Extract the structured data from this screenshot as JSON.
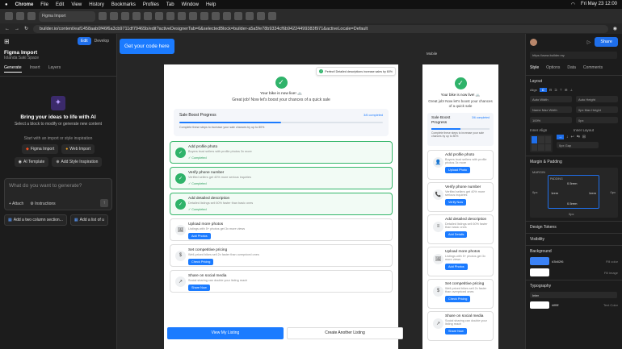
{
  "mac": {
    "menu": [
      "Chrome",
      "File",
      "Edit",
      "View",
      "History",
      "Bookmarks",
      "Profiles",
      "Tab",
      "Window",
      "Help"
    ],
    "datetime": "Fri May 23 12:00"
  },
  "tab": {
    "title": "Figma Import"
  },
  "address": {
    "url": "builder.io/content/eaf1458aab0f46f6a3cb9711df79465b/edit?activeDesignerTab=6&selectedBlock=builder-a5a5fe78b9334cf6b94224499383f971&activeLocale=Default"
  },
  "tooltip": {
    "text": "Get your code here"
  },
  "left": {
    "title": "Figma Import",
    "subtitle": "Iolanda Saki Space",
    "edit": "Edit",
    "develop": "Develop",
    "tabs": [
      "Generate",
      "Insert",
      "Layers"
    ],
    "headline": "Bring your ideas to life with AI",
    "sub": "Select a block to modify or generate new content",
    "start": "Start with an import or style inspiration",
    "figma": "Figma Import",
    "web": "Web Import",
    "ait": "AI Template",
    "style": "Add Style Inspiration",
    "placeholder": "What do you want to generate?",
    "attach": "Attach",
    "instructions": "Instructions",
    "s1": "Add a two column section...",
    "s2": "Add a list of u"
  },
  "main": {
    "toast": "Perfect! Detailed descriptions increase sales by 60%",
    "live": "Your bike is now live! 🚲",
    "great": "Great job! Now let's boost your chances of a quick sale",
    "sbp": "Sale Boost Progress",
    "completed": "3/6 completed",
    "hint": "Complete these steps to increase your sale chances by up to 80%",
    "tasks": [
      {
        "t": "Add profile photo",
        "d": "Buyers trust sellers with profile photos 3x more",
        "c": "✓ Completed",
        "b": ""
      },
      {
        "t": "Verify phone number",
        "d": "Verified sellers get 40% more serious inquiries",
        "c": "✓ Completed",
        "b": ""
      },
      {
        "t": "Add detailed description",
        "d": "Detailed listings sell 60% faster than basic ones",
        "c": "✓ Completed",
        "b": ""
      },
      {
        "t": "Upload more photos",
        "d": "Listings with 5+ photos get 3x more views",
        "c": "",
        "b": "Add Photos"
      },
      {
        "t": "Set competitive pricing",
        "d": "Well-priced bikes sell 2x faster than overpriced ones",
        "c": "",
        "b": "Check Pricing"
      },
      {
        "t": "Share on social media",
        "d": "Social sharing can double your listing reach",
        "c": "",
        "b": "Share Now"
      }
    ],
    "view": "View My Listing",
    "create": "Create Another Listing"
  },
  "mobile": {
    "label": "Mobile",
    "live": "Your bike is now live! 🚲",
    "great": "Great job! Now let's boost your chances of a quick sale",
    "sbp": "Sale Boost Progress",
    "completed": "3/6 completed",
    "hint": "Complete these steps to increase your sale chances by up to 80%",
    "tasks": [
      {
        "t": "Add profile photo",
        "d": "Buyers trust sellers with profile photos 3x more",
        "b": "Upload Photo"
      },
      {
        "t": "Verify phone number",
        "d": "Verified sellers get 40% more serious inquiries",
        "b": "Verify Now"
      },
      {
        "t": "Add detailed description",
        "d": "Detailed listings sell 60% faster than basic ones",
        "b": "Add Details"
      },
      {
        "t": "Upload more photos",
        "d": "Listings with 5+ photos get 3x more views",
        "b": "Add Photos"
      },
      {
        "t": "Set competitive pricing",
        "d": "Well-priced bikes sell 2x faster than overpriced ones",
        "b": "Check Pricing"
      },
      {
        "t": "Share on social media",
        "d": "Social sharing can double your listing reach",
        "b": "Share Now"
      }
    ]
  },
  "right": {
    "share": "Share",
    "url": "https://www.builder.my",
    "tabs": [
      "Style",
      "Options",
      "Data",
      "Comments"
    ],
    "layout": "Layout",
    "align": "Align",
    "width": "Width",
    "height": "Height",
    "auto": "Auto",
    "name": "Name",
    "maxw": "Max Width",
    "maxh": "Max Height",
    "pct": "100%",
    "px": "0px",
    "pxtop": "0px",
    "innerAlign": "Inner Align",
    "innerLayout": "Inner Layout",
    "gap": "Gap",
    "mp": "Margin & Padding",
    "margin": "MARGIN",
    "padding": "PADDING",
    "p1": "0.5rem",
    "p2": "1rem",
    "p3": "1rem",
    "p4": "0.5rem",
    "m0": "0px",
    "tokens": "Design Tokens",
    "visibility": "Visibility",
    "background": "Background",
    "bgcolor": "#3b82f6",
    "fillcolor": "Fill color",
    "fillimage": "Fill image",
    "typography": "Typography",
    "font": "Inter",
    "tcolor": "#ffffff",
    "tc": "Text Color"
  },
  "colors": {
    "accent": "#1b7bff",
    "green": "#2fb36a",
    "share": "#1f6feb"
  }
}
